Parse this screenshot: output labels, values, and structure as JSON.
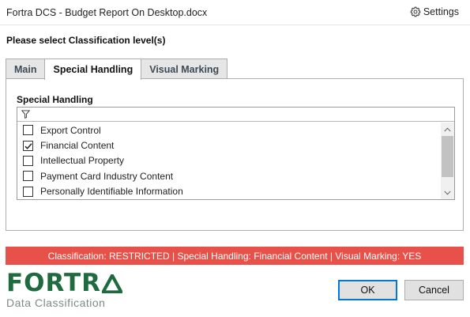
{
  "window": {
    "title": "Fortra DCS - Budget Report On Desktop.docx",
    "settings_label": "Settings"
  },
  "prompt": "Please select Classification level(s)",
  "tabs": [
    {
      "label": "Main",
      "active": false
    },
    {
      "label": "Special Handling",
      "active": true
    },
    {
      "label": "Visual Marking",
      "active": false
    }
  ],
  "special_handling": {
    "section_label": "Special Handling",
    "items": [
      {
        "label": "Export Control",
        "checked": false
      },
      {
        "label": "Financial Content",
        "checked": true
      },
      {
        "label": "Intellectual Property",
        "checked": false
      },
      {
        "label": "Payment Card Industry Content",
        "checked": false
      },
      {
        "label": "Personally Identifiable Information",
        "checked": false
      }
    ]
  },
  "status": {
    "text": "Classification: RESTRICTED | Special Handling: Financial Content | Visual Marking: YES",
    "color": "#e8514a"
  },
  "logo": {
    "word": "FORTR",
    "subtitle": "Data Classification",
    "color": "#1f6b3f"
  },
  "buttons": {
    "ok": "OK",
    "cancel": "Cancel"
  }
}
